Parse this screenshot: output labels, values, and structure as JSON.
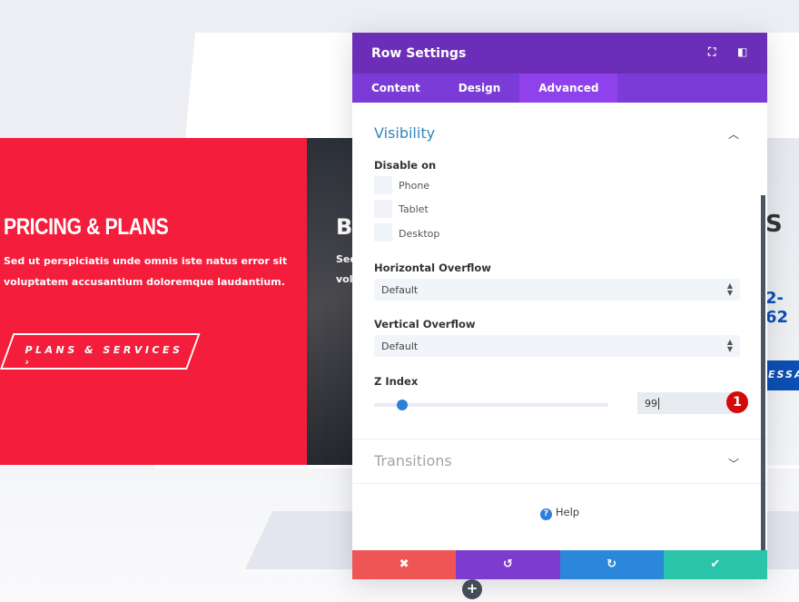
{
  "page": {
    "pricing": {
      "title": "PRICING & PLANS",
      "text": "Sed ut perspiciatis unde omnis iste natus error sit voluptatem accusantium doloremque laudantium.",
      "button": "PLANS & SERVICES ›"
    },
    "middle": {
      "title_fragment": "B",
      "text_line1": "Sed",
      "text_line2": "vol"
    },
    "right": {
      "title_fragment": "S",
      "phone_fragment": "2-62",
      "button_fragment": "ESSA"
    },
    "add_label": "+"
  },
  "colors": {
    "accent_red": "#f41e3c",
    "header_purple": "#6c2eb9",
    "tab_purple": "#7b3bd6",
    "active_tab": "#8f42ec",
    "cancel": "#ef5555",
    "undo": "#7e3bd0",
    "redo": "#2b87da",
    "save": "#29c4a9"
  },
  "modal": {
    "title": "Row Settings",
    "header_icons": [
      "fullscreen-icon",
      "sidebar-layout-icon"
    ],
    "tabs": [
      {
        "label": "Content"
      },
      {
        "label": "Design"
      },
      {
        "label": "Advanced",
        "active": true
      }
    ],
    "visibility": {
      "title": "Visibility",
      "disable_label": "Disable on",
      "options": [
        {
          "label": "Phone",
          "checked": false
        },
        {
          "label": "Tablet",
          "checked": false
        },
        {
          "label": "Desktop",
          "checked": false
        }
      ]
    },
    "horizontal_overflow": {
      "label": "Horizontal Overflow",
      "value": "Default"
    },
    "vertical_overflow": {
      "label": "Vertical Overflow",
      "value": "Default"
    },
    "z_index": {
      "label": "Z Index",
      "value": "99",
      "slider_percent": 12,
      "badge": "1"
    },
    "transitions": {
      "title": "Transitions"
    },
    "help": "Help",
    "footer": {
      "cancel": "✖",
      "undo": "↺",
      "redo": "↻",
      "save": "✔"
    }
  }
}
